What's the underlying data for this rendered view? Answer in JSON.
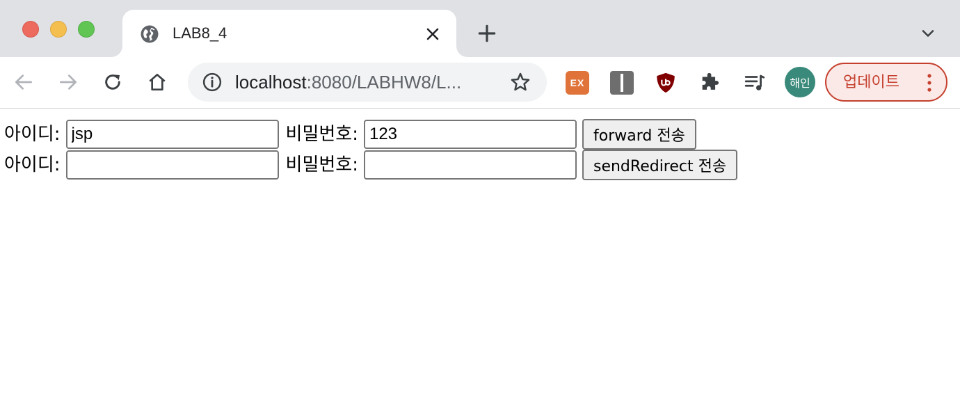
{
  "browser": {
    "tab": {
      "title": "LAB8_4"
    },
    "address": {
      "host": "localhost",
      "rest": ":8080/LABHW8/L..."
    },
    "extensions": {
      "ex_label": "EX"
    },
    "profile": {
      "avatar_text": "해인"
    },
    "update_label": "업데이트",
    "colors": {
      "update_accent": "#c5402e",
      "avatar_bg": "#3a8a7b",
      "ex_ext": "#e0733a"
    }
  },
  "forms": {
    "forward": {
      "id_label": "아이디:",
      "id_value": "jsp",
      "pw_label": "비밀번호:",
      "pw_value": "123",
      "submit_label": "forward 전송"
    },
    "redirect": {
      "id_label": "아이디:",
      "id_value": "",
      "pw_label": "비밀번호:",
      "pw_value": "",
      "submit_label": "sendRedirect 전송"
    }
  }
}
